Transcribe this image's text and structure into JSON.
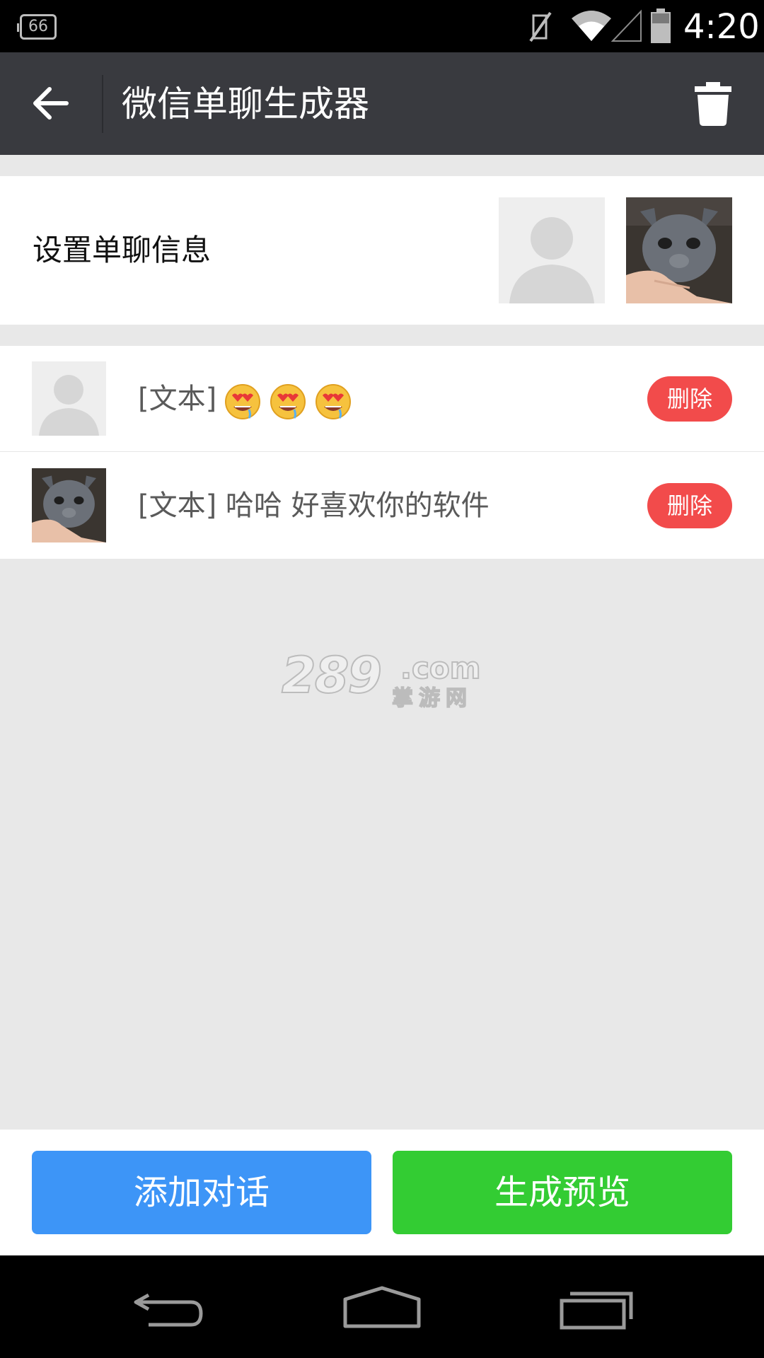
{
  "status_bar": {
    "notification_count": "66",
    "time": "4:20",
    "icons": [
      "notification-count-icon",
      "mute-icon",
      "wifi-icon",
      "signal-icon",
      "battery-icon"
    ]
  },
  "app_bar": {
    "title": "微信单聊生成器",
    "icons": [
      "back-arrow-icon",
      "trash-icon"
    ]
  },
  "settings": {
    "label": "设置单聊信息",
    "avatars": [
      "default-avatar",
      "cat-avatar"
    ]
  },
  "messages": [
    {
      "avatar": "default-avatar",
      "text": "[文本]",
      "emoji": [
        "drooling-heart-eyes-emoji",
        "drooling-heart-eyes-emoji",
        "drooling-heart-eyes-emoji"
      ],
      "delete_label": "删除"
    },
    {
      "avatar": "cat-avatar",
      "text": "[文本] 哈哈 好喜欢你的软件",
      "delete_label": "删除"
    }
  ],
  "watermark": {
    "main": "289",
    "suffix": ".com",
    "cn": "掌游网"
  },
  "buttons": {
    "add": "添加对话",
    "preview": "生成预览"
  },
  "colors": {
    "app_bar": "#393a3f",
    "delete": "#f24b4b",
    "add_button": "#3d95f7",
    "preview_button": "#33cc33",
    "background": "#e8e8e8"
  },
  "nav_bar": {
    "icons": [
      "nav-back-icon",
      "nav-home-icon",
      "nav-recent-apps-icon"
    ]
  }
}
